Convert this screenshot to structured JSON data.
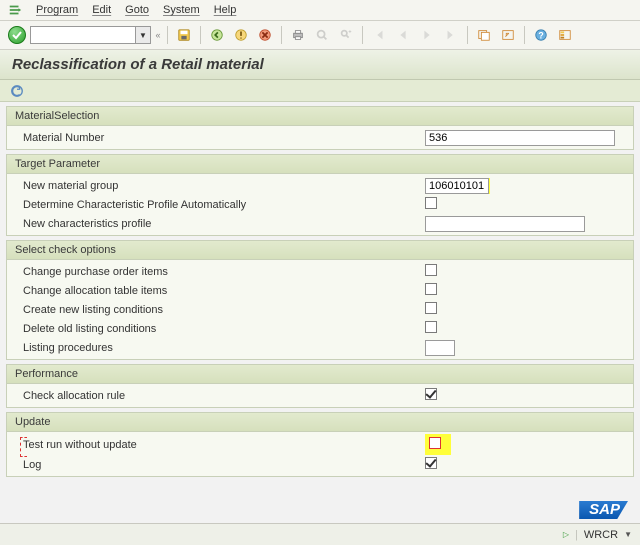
{
  "menu": {
    "program": "Program",
    "edit": "Edit",
    "goto": "Goto",
    "system": "System",
    "help": "Help"
  },
  "toolbar": {
    "command": "",
    "back_guillemet": "«"
  },
  "title": "Reclassification of a Retail material",
  "sections": {
    "materialSelection": {
      "header": "MaterialSelection",
      "materialNumber": {
        "label": "Material Number",
        "value": "536"
      }
    },
    "targetParameter": {
      "header": "Target Parameter",
      "newMaterialGroup": {
        "label": "New material group",
        "value": "106010101"
      },
      "determineCharProfile": {
        "label": "Determine Characteristic Profile Automatically",
        "checked": false
      },
      "newCharProfile": {
        "label": "New characteristics profile",
        "value": ""
      }
    },
    "selectCheckOptions": {
      "header": "Select check options",
      "changePO": {
        "label": "Change purchase order items",
        "checked": false
      },
      "changeAlloc": {
        "label": "Change allocation table items",
        "checked": false
      },
      "createListing": {
        "label": "Create new listing conditions",
        "checked": false
      },
      "deleteListing": {
        "label": "Delete old listing conditions",
        "checked": false
      },
      "listingProcedures": {
        "label": "Listing procedures",
        "value": ""
      }
    },
    "performance": {
      "header": "Performance",
      "checkAllocRule": {
        "label": "Check allocation rule",
        "checked": true
      }
    },
    "update": {
      "header": "Update",
      "testRun": {
        "label": "Test run without update",
        "checked": false
      },
      "log": {
        "label": "Log",
        "checked": true
      }
    }
  },
  "status": {
    "sap": "SAP",
    "system": "WRCR"
  }
}
